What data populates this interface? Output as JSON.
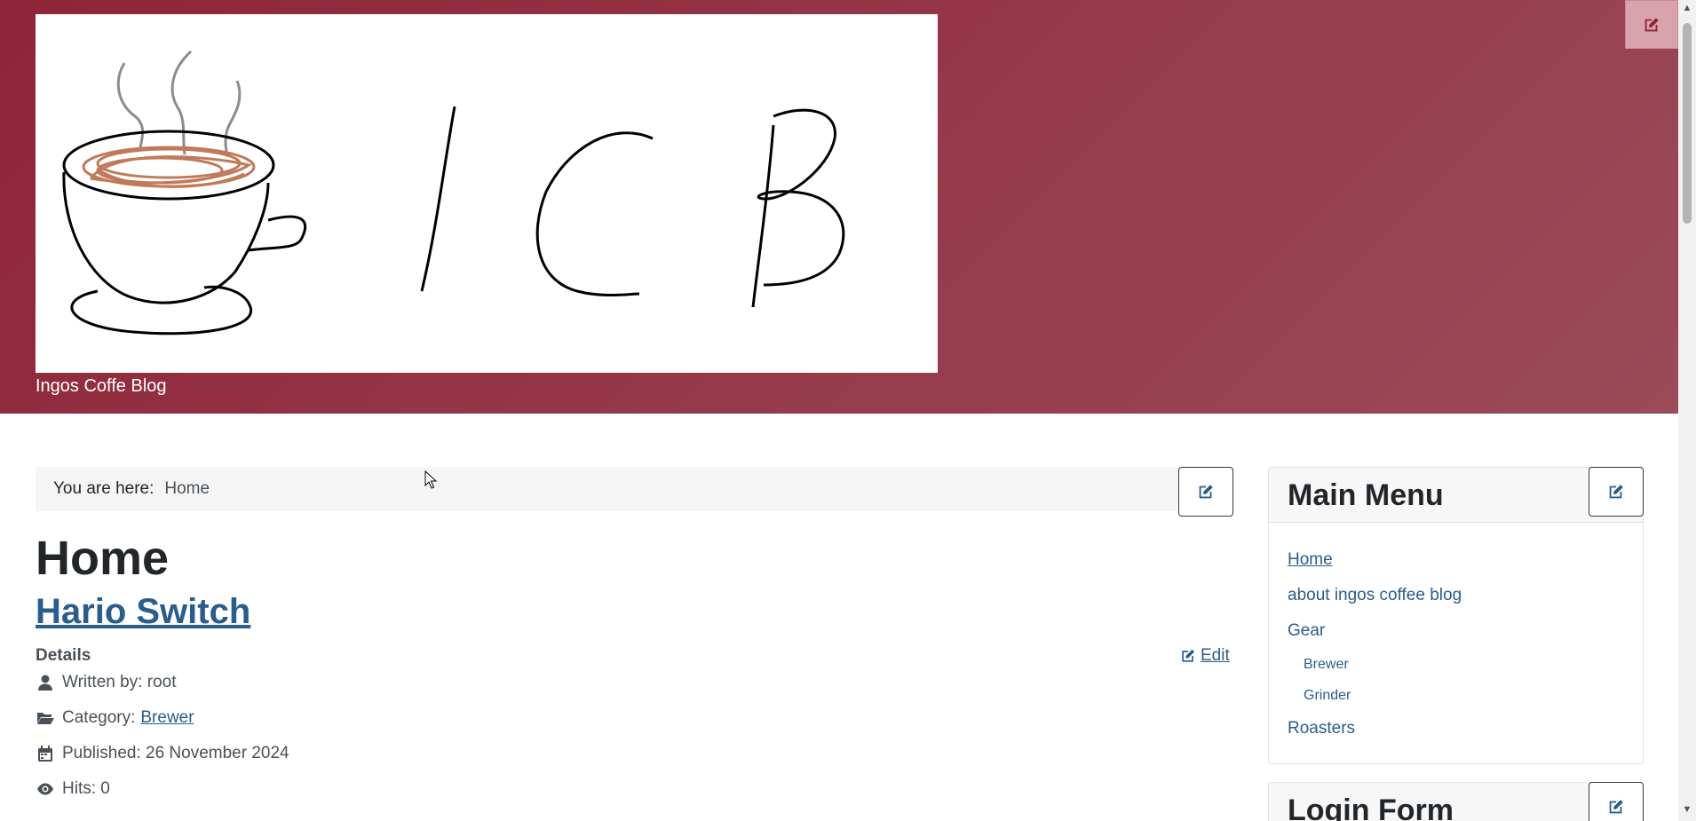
{
  "header": {
    "site_title": "Ingos Coffe Blog",
    "logo_text": "ICB"
  },
  "breadcrumb": {
    "label": "You are here:",
    "current": "Home"
  },
  "page": {
    "heading": "Home"
  },
  "article": {
    "title": "Hario Switch",
    "details_label": "Details",
    "edit_label": "Edit",
    "author": "Written by: root",
    "category_label": "Category:",
    "category_value": "Brewer",
    "published": "Published: 26 November 2024",
    "hits": "Hits: 0"
  },
  "sidebar": {
    "main_menu": {
      "title": "Main Menu",
      "items": [
        {
          "label": "Home",
          "active": true,
          "level": 1
        },
        {
          "label": "about ingos coffee blog",
          "level": 1
        },
        {
          "label": "Gear",
          "level": 1
        },
        {
          "label": "Brewer",
          "level": 2
        },
        {
          "label": "Grinder",
          "level": 2
        },
        {
          "label": "Roasters",
          "level": 1
        }
      ]
    },
    "login_form": {
      "title": "Login Form"
    }
  },
  "icons": {
    "edit": "pen-to-square-icon",
    "author": "user-icon",
    "category": "folder-open-icon",
    "published": "calendar-icon",
    "hits": "eye-icon"
  },
  "colors": {
    "header_bg": "#8e2438",
    "link": "#2a5d8c",
    "text": "#22262a",
    "muted": "#495057"
  }
}
